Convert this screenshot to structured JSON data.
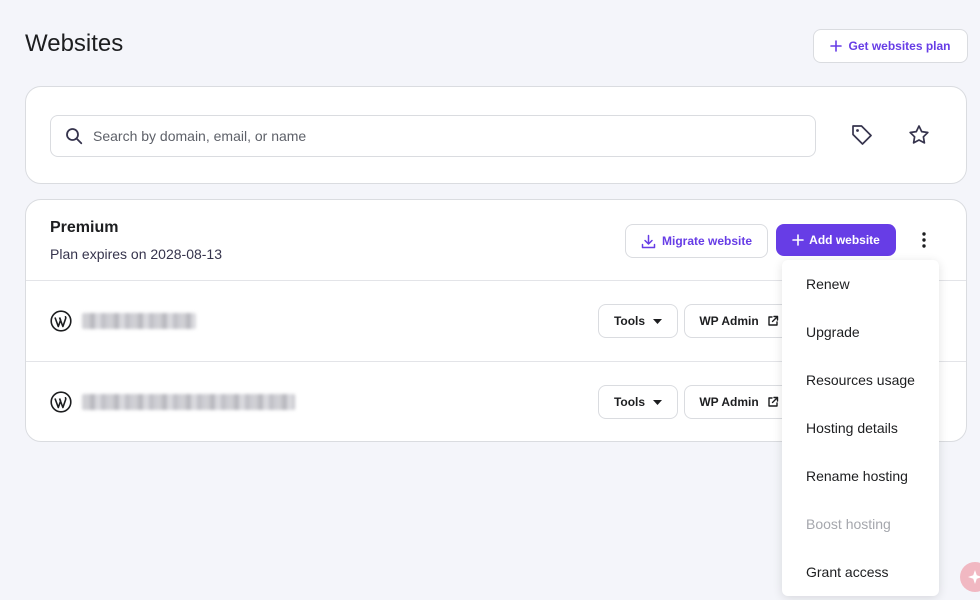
{
  "page": {
    "title": "Websites"
  },
  "header": {
    "get_plan_label": "Get websites plan"
  },
  "search": {
    "placeholder": "Search by domain, email, or name",
    "value": ""
  },
  "plan": {
    "name": "Premium",
    "expiry": "Plan expires on 2028-08-13",
    "migrate_label": "Migrate website",
    "add_label": "Add website"
  },
  "websites": [
    {
      "tools_label": "Tools",
      "wp_admin_label": "WP Admin"
    },
    {
      "tools_label": "Tools",
      "wp_admin_label": "WP Admin"
    }
  ],
  "menu": {
    "items": [
      {
        "label": "Renew",
        "disabled": false
      },
      {
        "label": "Upgrade",
        "disabled": false
      },
      {
        "label": "Resources usage",
        "disabled": false
      },
      {
        "label": "Hosting details",
        "disabled": false
      },
      {
        "label": "Rename hosting",
        "disabled": false
      },
      {
        "label": "Boost hosting",
        "disabled": true
      },
      {
        "label": "Grant access",
        "disabled": false
      }
    ]
  },
  "colors": {
    "accent": "#673de6",
    "background": "#f4f5fa",
    "border": "#dadce0"
  }
}
